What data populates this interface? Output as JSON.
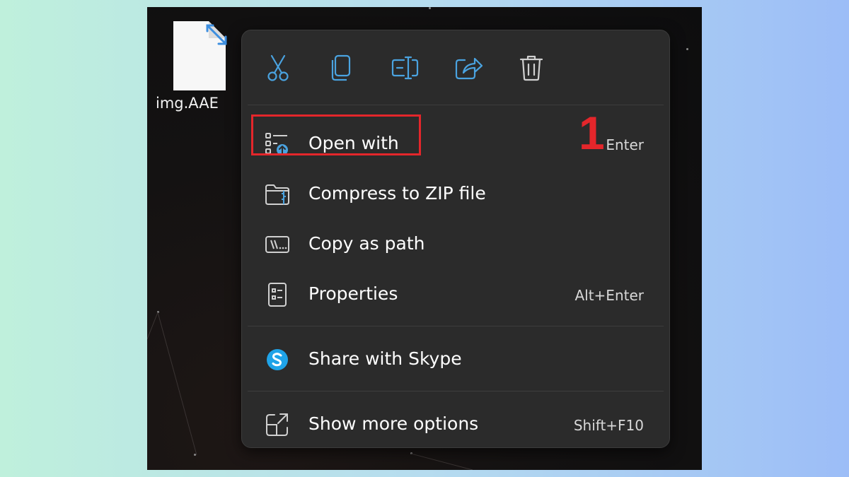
{
  "desktop": {
    "file_name": "img.AAE"
  },
  "toolbar": {
    "buttons": [
      {
        "name": "cut",
        "icon": "scissors-icon"
      },
      {
        "name": "copy",
        "icon": "copy-icon"
      },
      {
        "name": "rename",
        "icon": "rename-icon"
      },
      {
        "name": "share",
        "icon": "share-icon"
      },
      {
        "name": "delete",
        "icon": "trash-icon"
      }
    ]
  },
  "menu": {
    "items": [
      {
        "label": "Open with",
        "shortcut": "Enter",
        "icon": "open-with-icon"
      },
      {
        "label": "Compress to ZIP file",
        "shortcut": "",
        "icon": "zip-folder-icon"
      },
      {
        "label": "Copy as path",
        "shortcut": "",
        "icon": "path-icon"
      },
      {
        "label": "Properties",
        "shortcut": "Alt+Enter",
        "icon": "properties-icon"
      },
      {
        "label": "Share with Skype",
        "shortcut": "",
        "icon": "skype-icon"
      },
      {
        "label": "Show more options",
        "shortcut": "Shift+F10",
        "icon": "more-options-icon"
      }
    ]
  },
  "annotation": {
    "step_number": "1",
    "highlight_color": "#e4262b"
  },
  "colors": {
    "accent": "#4aa3e0",
    "menu_bg": "#2b2b2b",
    "skype": "#1fa3e8"
  }
}
